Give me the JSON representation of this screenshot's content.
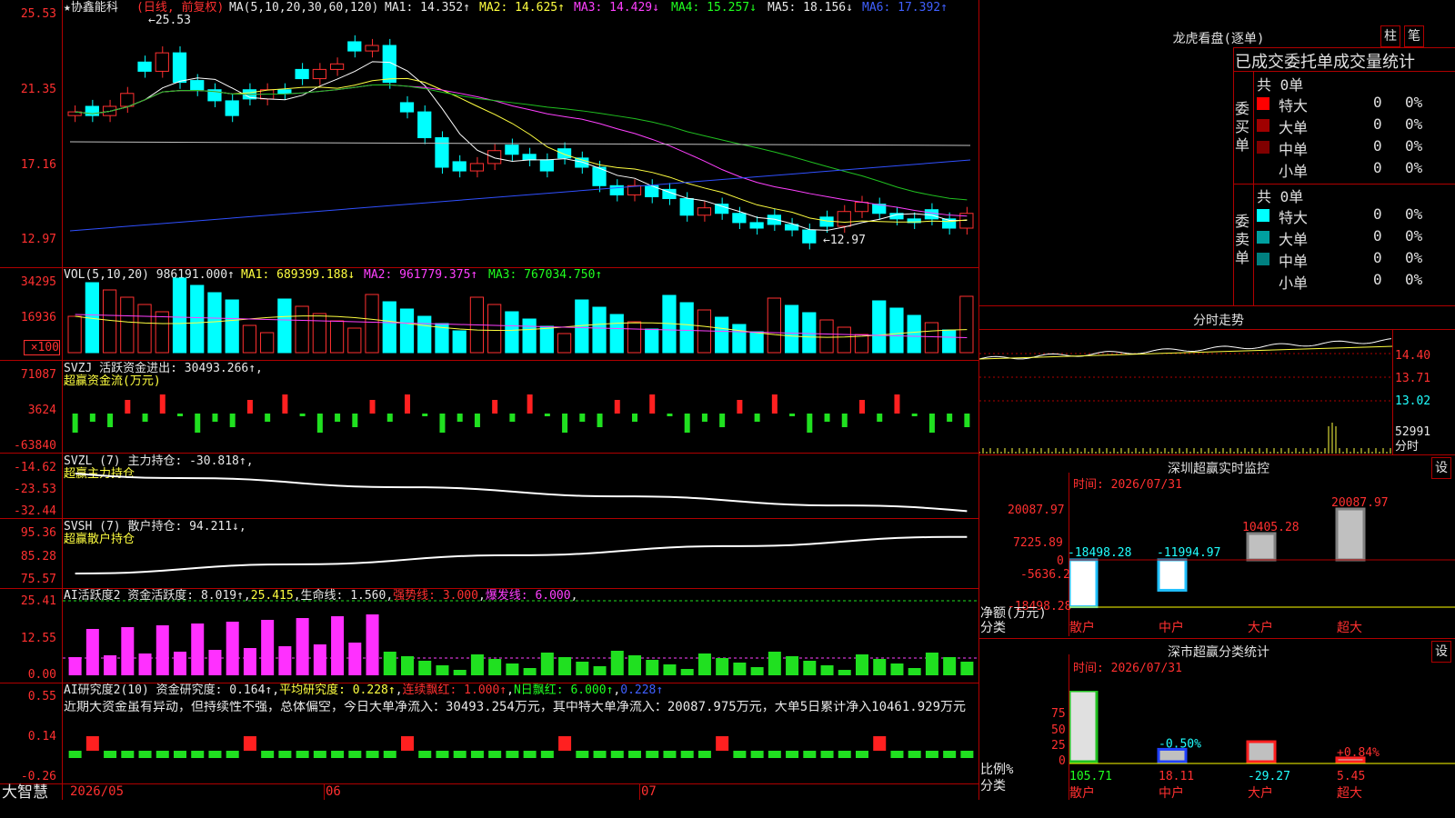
{
  "stock": {
    "title": "★协鑫能科",
    "period": "(日线, 前复权)",
    "ma_line": {
      "label": "MA(5,10,20,30,60,120)",
      "ma1": "MA1: 14.352↑",
      "ma2": "MA2: 14.625↑",
      "ma3": "MA3: 14.429↓",
      "ma4": "MA4: 15.257↓",
      "ma5": "MA5: 18.156↓",
      "ma6": "MA6: 17.392↑"
    },
    "price_axis": [
      "25.53",
      "21.35",
      "17.16",
      "12.97"
    ],
    "high_label": "25.53",
    "low_label": "12.97"
  },
  "vol": {
    "label": "VOL(5,10,20)",
    "value": "986191.000↑",
    "ma1": "MA1: 689399.188↓",
    "ma2": "MA2: 961779.375↑",
    "ma3": "MA3: 767034.750↑",
    "axis": [
      "34295",
      "16936",
      "×100"
    ]
  },
  "svzj": {
    "label": "SVZJ  活跃资金进出: 30493.266↑,",
    "sub": "超赢资金流(万元)",
    "axis": [
      "71087",
      "3624",
      "-63840"
    ]
  },
  "svzl": {
    "label": "SVZL (7) 主力持仓: -30.818↑,",
    "sub": "超赢主力持仓",
    "axis": [
      "-14.62",
      "-23.53",
      "-32.44"
    ]
  },
  "svsh": {
    "label": "SVSH (7) 散户持仓: 94.211↓,",
    "sub": "超赢散户持仓",
    "axis": [
      "95.36",
      "85.28",
      "75.57"
    ]
  },
  "ai1": {
    "label": "AI活跃度2 资金活跃度: 8.019↑",
    "v2": "25.415",
    "v3": "生命线: 1.560",
    "v4": "强势线: 3.000",
    "v5": "爆发线: 6.000",
    "axis": [
      "25.41",
      "12.55",
      "0.00"
    ]
  },
  "ai2": {
    "label": "AI研究度2(10) 资金研究度: 0.164↑",
    "v2": "平均研究度: 0.228↑",
    "v3": "连续飘红: 1.000↑",
    "v4": "N日飘红: 6.000↑",
    "v5": "0.228↑",
    "note": "近期大资金虽有异动，但持续性不强，总体偏空，今日大单净流入：30493.254万元，其中特大单净流入：20087.975万元，大单5日累计净入10461.929万元",
    "axis": [
      "0.55",
      "0.14",
      "-0.26"
    ]
  },
  "dates": [
    "2026/05",
    "06",
    "07"
  ],
  "logo": "大智慧",
  "dragon": {
    "title": "龙虎看盘(逐单)",
    "btn1": "柱",
    "btn2": "笔",
    "section": "已成交委托单成交量统计",
    "buy_label": "委买单",
    "sell_label": "委卖单",
    "buy_total": "共 0单",
    "sell_total": "共 0单",
    "buy_rows": [
      {
        "name": "特大",
        "n": "0",
        "p": "0%",
        "color": "#ff0000"
      },
      {
        "name": "大单",
        "n": "0",
        "p": "0%",
        "color": "#a00000"
      },
      {
        "name": "中单",
        "n": "0",
        "p": "0%",
        "color": "#800000"
      },
      {
        "name": "小单",
        "n": "0",
        "p": "0%",
        "color": "#000000"
      }
    ],
    "sell_rows": [
      {
        "name": "特大",
        "n": "0",
        "p": "0%",
        "color": "#00ffff"
      },
      {
        "name": "大单",
        "n": "0",
        "p": "0%",
        "color": "#00a0a0"
      },
      {
        "name": "中单",
        "n": "0",
        "p": "0%",
        "color": "#008080"
      },
      {
        "name": "小单",
        "n": "0",
        "p": "0%",
        "color": "#000000"
      }
    ]
  },
  "intraday": {
    "title": "分时走势",
    "axis": [
      "14.40",
      "13.71",
      "13.02"
    ],
    "vol_axis": "52991",
    "vol_label": "分时"
  },
  "sz_monitor": {
    "title": "深圳超赢实时监控",
    "btn": "设",
    "time": "时间: 2026/07/31",
    "axis": [
      "20087.97",
      "7225.89",
      "0",
      "-5636.2",
      "-18498.28"
    ],
    "ylabel1": "净额(万元)",
    "ylabel2": "分类",
    "values": [
      "-18498.28",
      "-11994.97",
      "10405.28",
      "20087.97"
    ],
    "cats": [
      "散户",
      "中户",
      "大户",
      "超大"
    ]
  },
  "sz_stats": {
    "title": "深市超赢分类统计",
    "btn": "设",
    "time": "时间: 2026/07/31",
    "axis": [
      "75",
      "50",
      "25",
      "0"
    ],
    "ylabel1": "比例%",
    "ylabel2": "分类",
    "pct_labels": [
      "",
      "-0.50%",
      "",
      "+0.84%"
    ],
    "values": [
      "105.71",
      "18.11",
      "-29.27",
      "5.45"
    ],
    "cats": [
      "散户",
      "中户",
      "大户",
      "超大"
    ]
  },
  "chart_data": {
    "type": "candlestick",
    "title": "协鑫能科 日线 前复权",
    "ylim": [
      12.97,
      25.53
    ],
    "closes": [
      20.6,
      20.4,
      20.9,
      21.6,
      22.8,
      23.8,
      22.2,
      21.8,
      21.2,
      20.4,
      21.3,
      21.8,
      21.6,
      22.4,
      22.9,
      23.2,
      23.9,
      24.2,
      22.2,
      20.6,
      19.2,
      17.6,
      17.4,
      17.8,
      18.5,
      18.3,
      18.0,
      17.4,
      18.1,
      17.6,
      16.6,
      16.1,
      16.6,
      16.0,
      15.9,
      15.0,
      15.4,
      15.1,
      14.6,
      14.3,
      14.5,
      14.2,
      13.5,
      14.4,
      15.2,
      15.7,
      15.1,
      14.8,
      14.6,
      14.8,
      14.3,
      15.1
    ]
  }
}
